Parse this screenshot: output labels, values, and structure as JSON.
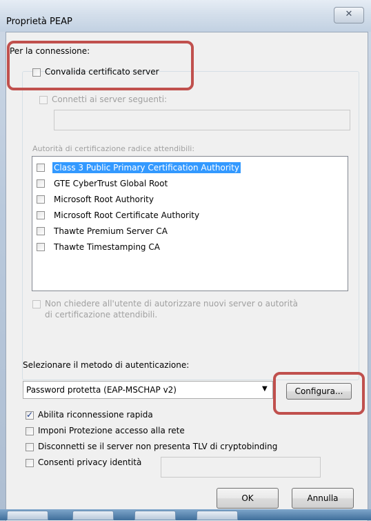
{
  "window": {
    "title": "Proprietà PEAP",
    "close_glyph": "✕"
  },
  "connection": {
    "group_label": "Per la connessione:",
    "validate_cert_label": "Convalida certificato server",
    "validate_cert_checked": false,
    "connect_servers_label": "Connetti ai server seguenti:",
    "connect_servers_checked": false,
    "servers_value": "",
    "trusted_ca_label": "Autorità di certificazione radice attendibili:",
    "trusted_ca_items": [
      {
        "label": "Class 3 Public Primary Certification Authority",
        "checked": false,
        "selected": true
      },
      {
        "label": "GTE CyberTrust Global Root",
        "checked": false,
        "selected": false
      },
      {
        "label": "Microsoft Root Authority",
        "checked": false,
        "selected": false
      },
      {
        "label": "Microsoft Root Certificate Authority",
        "checked": false,
        "selected": false
      },
      {
        "label": "Thawte Premium Server CA",
        "checked": false,
        "selected": false
      },
      {
        "label": "Thawte Timestamping CA",
        "checked": false,
        "selected": false
      }
    ],
    "no_prompt_label_line1": "Non chiedere all'utente di autorizzare nuovi server o autorità",
    "no_prompt_label_line2": "di certificazione attendibili.",
    "no_prompt_checked": false
  },
  "auth": {
    "method_label": "Selezionare il metodo di autenticazione:",
    "method_value": "Password protetta (EAP-MSCHAP v2)",
    "configure_label": "Configura...",
    "options": [
      {
        "label": "Abilita riconnessione rapida",
        "checked": true
      },
      {
        "label": "Imponi Protezione accesso alla rete",
        "checked": false
      },
      {
        "label": "Disconnetti se il server non presenta TLV di cryptobinding",
        "checked": false
      },
      {
        "label": "Consenti privacy identità",
        "checked": false
      }
    ],
    "privacy_identity_value": ""
  },
  "buttons": {
    "ok": "OK",
    "cancel": "Annulla"
  },
  "colors": {
    "highlight": "#c0504d",
    "selection": "#3399ff"
  },
  "icons": {
    "dropdown": "chevron-down-icon",
    "checkmark": "checkmark-icon"
  }
}
